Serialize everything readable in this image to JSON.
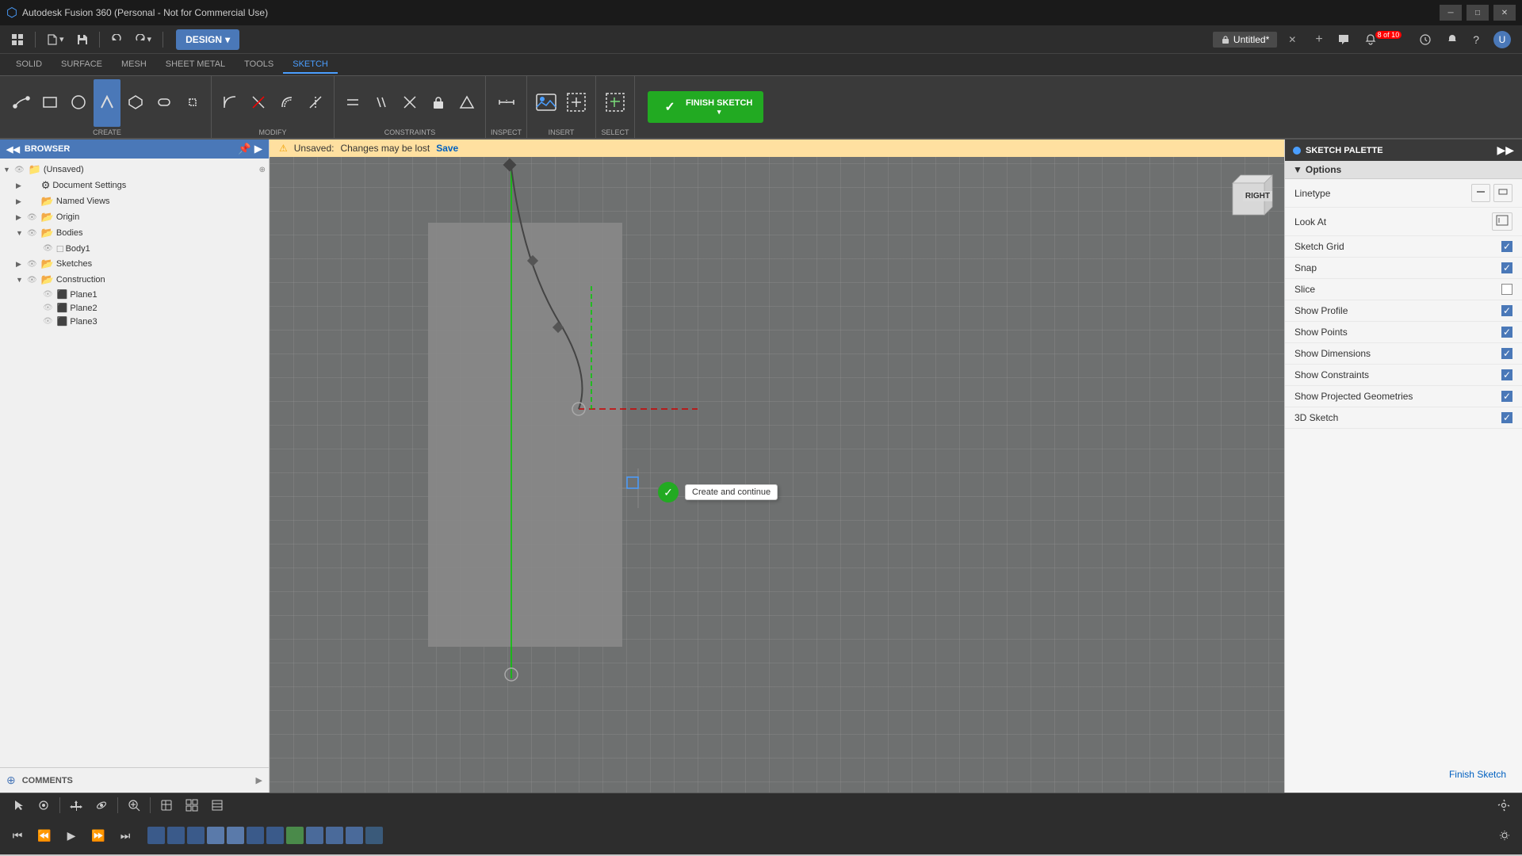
{
  "titlebar": {
    "title": "Autodesk Fusion 360 (Personal - Not for Commercial Use)",
    "app_name": "Autodesk Fusion 360 (Personal - Not for Commercial Use)"
  },
  "top_tabs": {
    "items": [
      "SOLID",
      "SURFACE",
      "MESH",
      "SHEET METAL",
      "TOOLS",
      "SKETCH"
    ],
    "active": "SKETCH"
  },
  "toolbar": {
    "design_label": "DESIGN",
    "groups": {
      "create": "CREATE",
      "modify": "MODIFY",
      "constraints": "CONSTRAINTS",
      "inspect": "INSPECT",
      "insert": "INSERT",
      "select": "SELECT",
      "finish_sketch": "FINISH SKETCH"
    }
  },
  "browser": {
    "title": "BROWSER",
    "items": [
      {
        "label": "(Unsaved)",
        "indent": 0,
        "type": "folder",
        "expanded": true
      },
      {
        "label": "Document Settings",
        "indent": 1,
        "type": "settings"
      },
      {
        "label": "Named Views",
        "indent": 1,
        "type": "folder"
      },
      {
        "label": "Origin",
        "indent": 1,
        "type": "folder"
      },
      {
        "label": "Bodies",
        "indent": 1,
        "type": "folder",
        "expanded": true
      },
      {
        "label": "Body1",
        "indent": 2,
        "type": "body"
      },
      {
        "label": "Sketches",
        "indent": 1,
        "type": "folder"
      },
      {
        "label": "Construction",
        "indent": 1,
        "type": "folder",
        "expanded": true
      },
      {
        "label": "Plane1",
        "indent": 2,
        "type": "plane"
      },
      {
        "label": "Plane2",
        "indent": 2,
        "type": "plane"
      },
      {
        "label": "Plane3",
        "indent": 2,
        "type": "plane"
      }
    ]
  },
  "unsaved_bar": {
    "warning": "Unsaved:",
    "message": "Changes may be lost",
    "save_link": "Save"
  },
  "sketch_palette": {
    "title": "SKETCH PALETTE",
    "sections": {
      "options": "Options"
    },
    "rows": [
      {
        "label": "Linetype",
        "type": "icons",
        "checked": null
      },
      {
        "label": "Look At",
        "type": "icon_btn",
        "checked": null
      },
      {
        "label": "Sketch Grid",
        "type": "checkbox",
        "checked": true
      },
      {
        "label": "Snap",
        "type": "checkbox",
        "checked": true
      },
      {
        "label": "Slice",
        "type": "checkbox",
        "checked": false
      },
      {
        "label": "Show Profile",
        "type": "checkbox",
        "checked": true
      },
      {
        "label": "Show Points",
        "type": "checkbox",
        "checked": true
      },
      {
        "label": "Show Dimensions",
        "type": "checkbox",
        "checked": true
      },
      {
        "label": "Show Constraints",
        "type": "checkbox",
        "checked": true
      },
      {
        "label": "Show Projected Geometries",
        "type": "checkbox",
        "checked": true
      },
      {
        "label": "3D Sketch",
        "type": "checkbox",
        "checked": true
      }
    ],
    "finish_sketch_btn": "Finish Sketch"
  },
  "bottom_nav": {
    "playback_controls": [
      "skip-back",
      "step-back",
      "play",
      "step-forward",
      "skip-forward"
    ],
    "timeline_items": [
      "rect1",
      "rect2",
      "rect3",
      "rect4",
      "rect5",
      "rect6",
      "rect7",
      "rect8",
      "rect9",
      "rect10",
      "rect11",
      "rect12"
    ]
  },
  "viewport": {
    "tooltip": "Create and continue",
    "view_label": "RIGHT"
  },
  "comments": {
    "label": "COMMENTS"
  }
}
